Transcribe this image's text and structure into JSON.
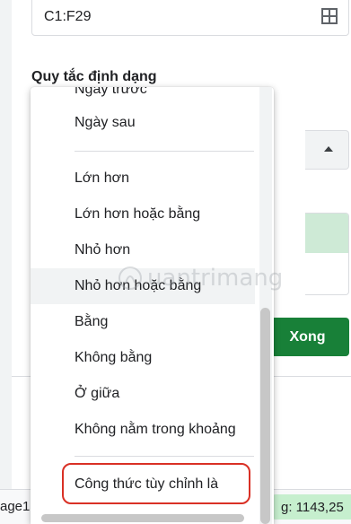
{
  "range_input": {
    "value": "C1:F29"
  },
  "section": {
    "label": "Quy tắc định dạng"
  },
  "menu": {
    "items": [
      "Ngày trước",
      "Ngày sau",
      "Lớn hơn",
      "Lớn hơn hoặc bằng",
      "Nhỏ hơn",
      "Nhỏ hơn hoặc bằng",
      "Bằng",
      "Không bằng",
      "Ở giữa",
      "Không nằm trong khoảng",
      "Công thức tùy chỉnh là"
    ]
  },
  "done_button": {
    "label": "Xong"
  },
  "footer": {
    "sheet_tab": "age1",
    "sum_text": "g: 1143,25"
  },
  "watermark": {
    "text": "uantrimang"
  },
  "colors": {
    "accent_green": "#188038",
    "highlight_red": "#d93025",
    "preview_green": "#ceead6"
  }
}
